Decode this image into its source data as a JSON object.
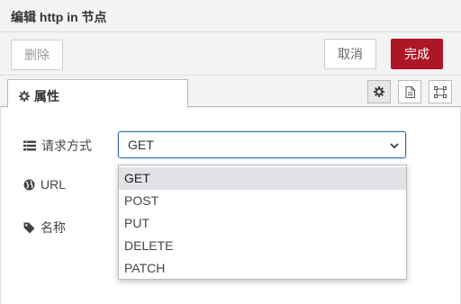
{
  "header": {
    "title": "编辑 http in 节点"
  },
  "toolbar": {
    "delete_label": "删除",
    "cancel_label": "取消",
    "done_label": "完成"
  },
  "tabs": {
    "active_label": "属性"
  },
  "form": {
    "method_label": "请求方式",
    "url_label": "URL",
    "name_label": "名称",
    "method_value": "GET"
  },
  "dropdown": {
    "options": [
      "GET",
      "POST",
      "PUT",
      "DELETE",
      "PATCH"
    ],
    "selected": "GET"
  },
  "colors": {
    "accent": "#ad1625",
    "focus": "#2f6db3"
  }
}
